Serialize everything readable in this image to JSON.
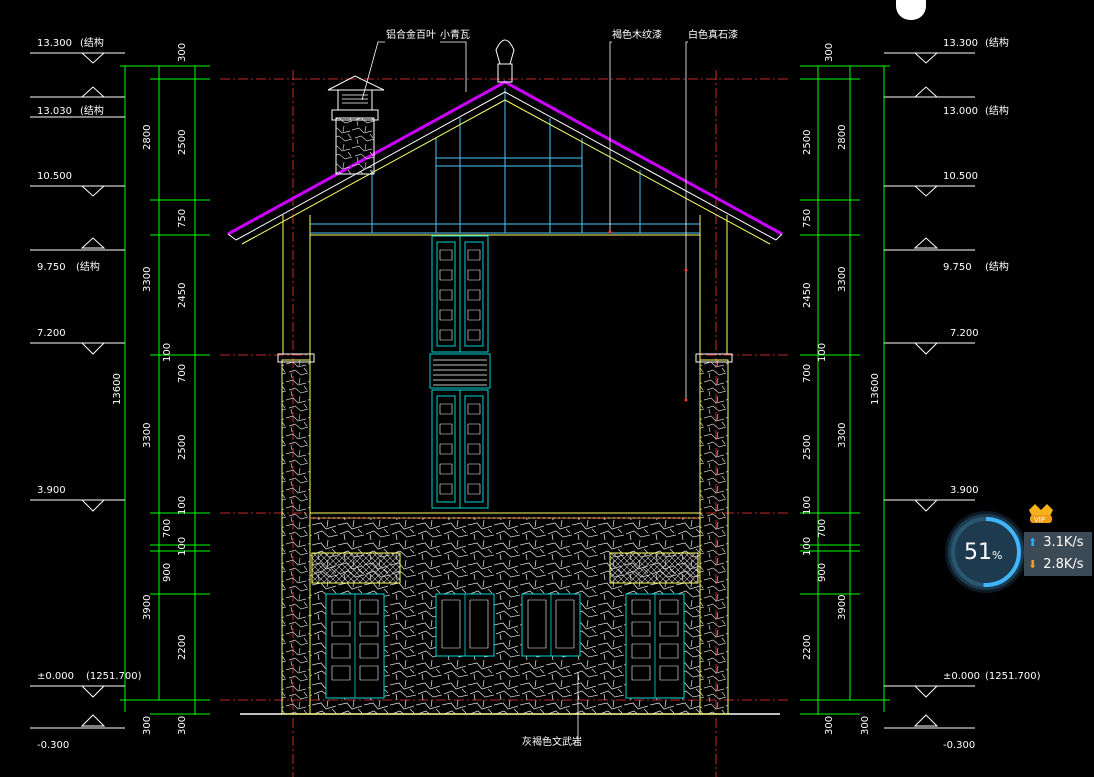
{
  "labels": {
    "louver": "铝合金百叶",
    "small_tile": "小青瓦",
    "brown_wood_paint": "褐色木纹漆",
    "white_stone_paint": "白色真石漆",
    "gray_stone_base": "灰褐色文武岩"
  },
  "left_levels": [
    {
      "value": "13.300",
      "note": "(结构"
    },
    {
      "value": "13.030",
      "note": "(结构"
    },
    {
      "value": "10.500",
      "note": ""
    },
    {
      "value": "9.750",
      "note": "(结构"
    },
    {
      "value": "7.200",
      "note": ""
    },
    {
      "value": "3.900",
      "note": ""
    },
    {
      "value": "±0.000",
      "note": "(1251.700)"
    },
    {
      "value": "-0.300",
      "note": ""
    }
  ],
  "right_levels": [
    {
      "value": "13.300",
      "note": "(结构"
    },
    {
      "value": "13.000",
      "note": "(结构"
    },
    {
      "value": "10.500",
      "note": ""
    },
    {
      "value": "9.750",
      "note": "(结构"
    },
    {
      "value": "7.200",
      "note": ""
    },
    {
      "value": "3.900",
      "note": ""
    },
    {
      "value": "±0.000",
      "note": "(1251.700)"
    },
    {
      "value": "-0.300",
      "note": ""
    }
  ],
  "dims": {
    "d300": "300",
    "d2800": "2800",
    "d2500": "2500",
    "d750": "750",
    "d3300": "3300",
    "d2450": "2450",
    "d100": "100",
    "d700": "700",
    "d3900": "3900",
    "d900": "900",
    "d2200": "2200",
    "total": "13600"
  },
  "network": {
    "percent": "51",
    "percent_unit": "%",
    "up": "3.1K/s",
    "down": "2.8K/s",
    "badge": "VIP"
  },
  "colors": {
    "background": "#000000",
    "dim_green": "#00ff00",
    "dim_red": "#ff3333",
    "level_white": "#ffffff",
    "roof_magenta": "#cc00ff",
    "window_cyan": "#00d5d5",
    "wall_yellow": "#ffff66"
  }
}
